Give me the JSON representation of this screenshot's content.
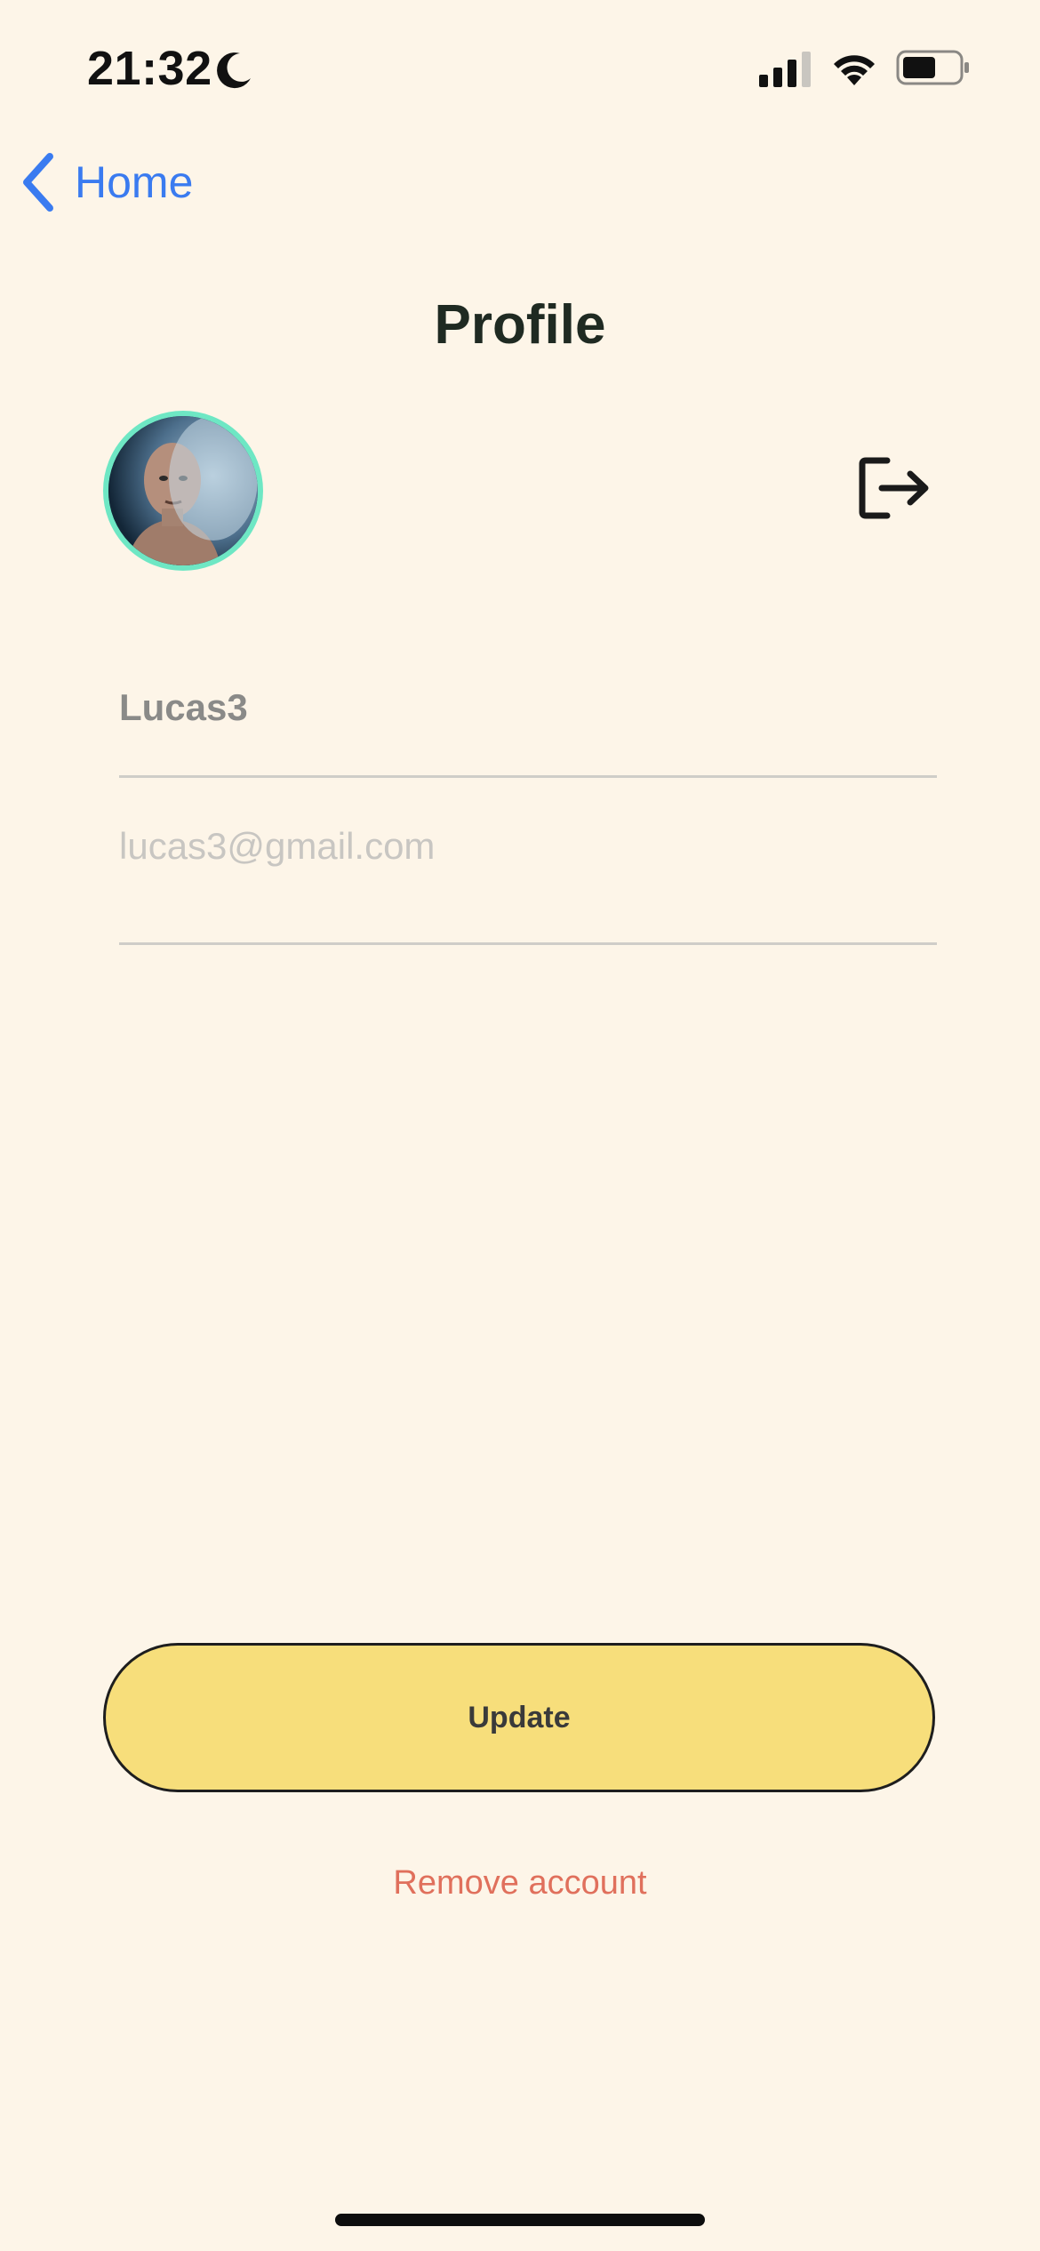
{
  "status_bar": {
    "time": "21:32",
    "icons": [
      "moon-icon",
      "signal-icon",
      "wifi-icon",
      "battery-icon"
    ]
  },
  "nav": {
    "back_label": "Home",
    "back_icon": "chevron-left-icon",
    "accent_color": "#3a7bf0"
  },
  "page": {
    "title": "Profile"
  },
  "profile": {
    "avatar_ring_color": "#6ee7c4",
    "logout_icon": "logout-icon"
  },
  "form": {
    "username_value": "Lucas3",
    "email_placeholder": "lucas3@gmail.com"
  },
  "actions": {
    "update_label": "Update",
    "update_color": "#f7de7b",
    "remove_label": "Remove account",
    "remove_color": "#e0705c"
  }
}
